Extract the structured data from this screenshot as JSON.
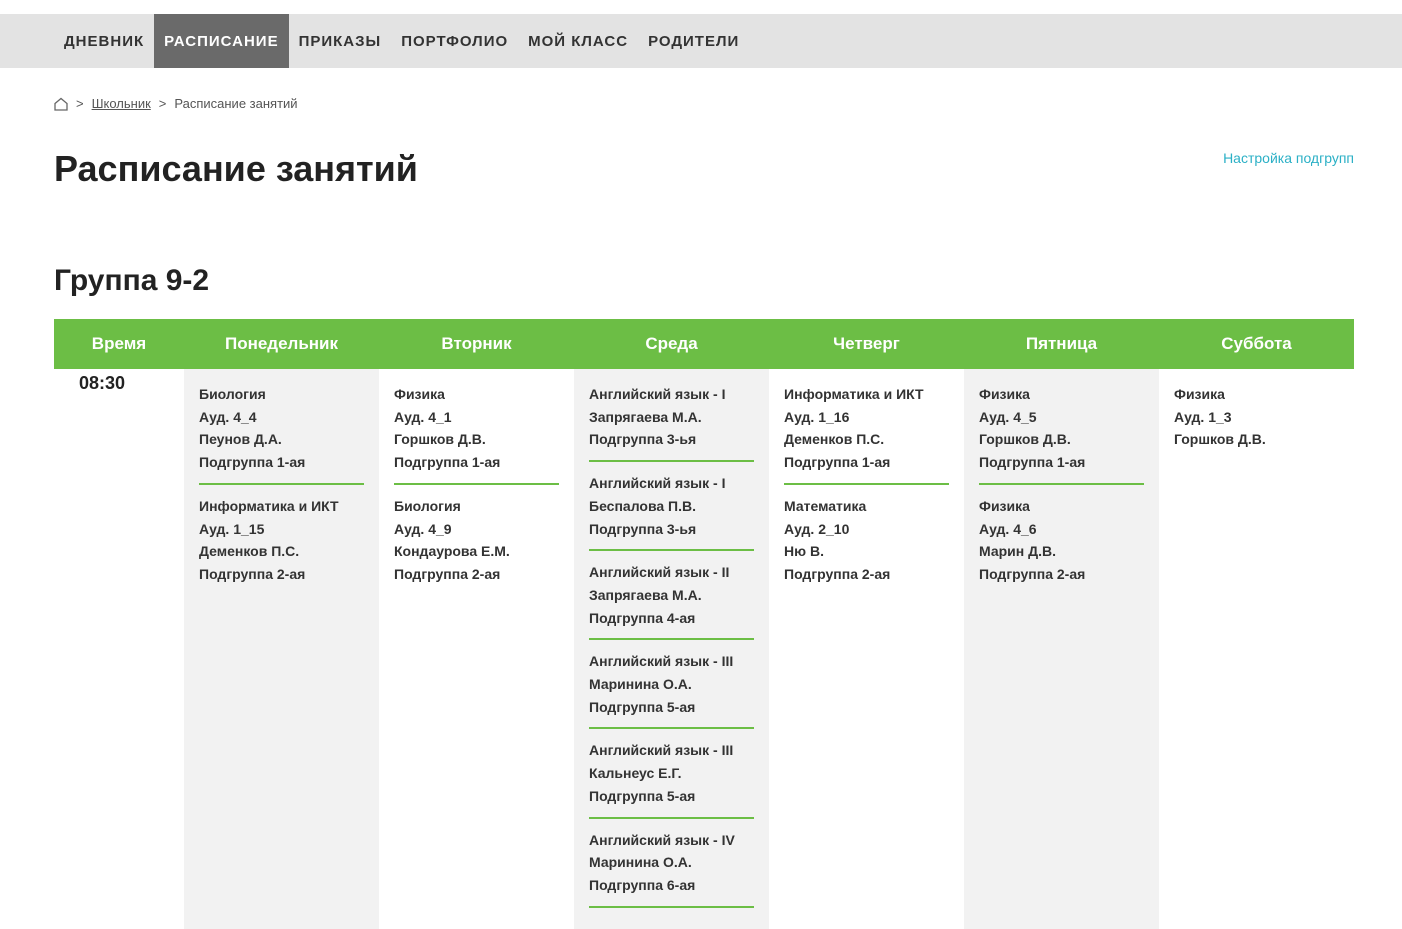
{
  "nav": {
    "items": [
      "Дневник",
      "Расписание",
      "Приказы",
      "Портфолио",
      "Мой класс",
      "Родители"
    ],
    "active_index": 1
  },
  "breadcrumb": {
    "home_icon": "home-icon",
    "separator": ">",
    "link": "Школьник",
    "current": "Расписание занятий"
  },
  "page": {
    "title": "Расписание занятий",
    "subgroup_settings": "Настройка подгрупп",
    "group_title": "Группа 9-2"
  },
  "colors": {
    "accent": "#6cbe45",
    "link": "#2bb0c6",
    "nav_active": "#6a6a6a"
  },
  "schedule": {
    "headers": [
      "Время",
      "Понедельник",
      "Вторник",
      "Среда",
      "Четверг",
      "Пятница",
      "Суббота"
    ],
    "time": "08:30",
    "days": [
      [
        [
          "Биология",
          "Ауд. 4_4",
          "Пеунов Д.А.",
          "Подгруппа 1-ая"
        ],
        [
          "Информатика и ИКТ",
          "Ауд. 1_15",
          "Деменков П.С.",
          "Подгруппа 2-ая"
        ]
      ],
      [
        [
          "Физика",
          "Ауд. 4_1",
          "Горшков Д.В.",
          "Подгруппа 1-ая"
        ],
        [
          "Биология",
          "Ауд. 4_9",
          "Кондаурова Е.М.",
          "Подгруппа 2-ая"
        ]
      ],
      [
        [
          "Английский язык - I",
          "Запрягаева М.А.",
          "Подгруппа 3-ья"
        ],
        [
          "Английский язык - I",
          "Беспалова П.В.",
          "Подгруппа 3-ья"
        ],
        [
          "Английский язык - II",
          "Запрягаева М.А.",
          "Подгруппа 4-ая"
        ],
        [
          "Английский язык - III",
          "Маринина О.А.",
          "Подгруппа 5-ая"
        ],
        [
          "Английский язык - III",
          "Кальнеус Е.Г.",
          "Подгруппа 5-ая"
        ],
        [
          "Английский язык - IV",
          "Маринина О.А.",
          "Подгруппа 6-ая"
        ]
      ],
      [
        [
          "Информатика и ИКТ",
          "Ауд. 1_16",
          "Деменков П.С.",
          "Подгруппа 1-ая"
        ],
        [
          "Математика",
          "Ауд. 2_10",
          "Ню В.",
          "Подгруппа 2-ая"
        ]
      ],
      [
        [
          "Физика",
          "Ауд. 4_5",
          "Горшков Д.В.",
          "Подгруппа 1-ая"
        ],
        [
          "Физика",
          "Ауд. 4_6",
          "Марин Д.В.",
          "Подгруппа 2-ая"
        ]
      ],
      [
        [
          "Физика",
          "Ауд. 1_3",
          "Горшков Д.В."
        ]
      ]
    ]
  }
}
